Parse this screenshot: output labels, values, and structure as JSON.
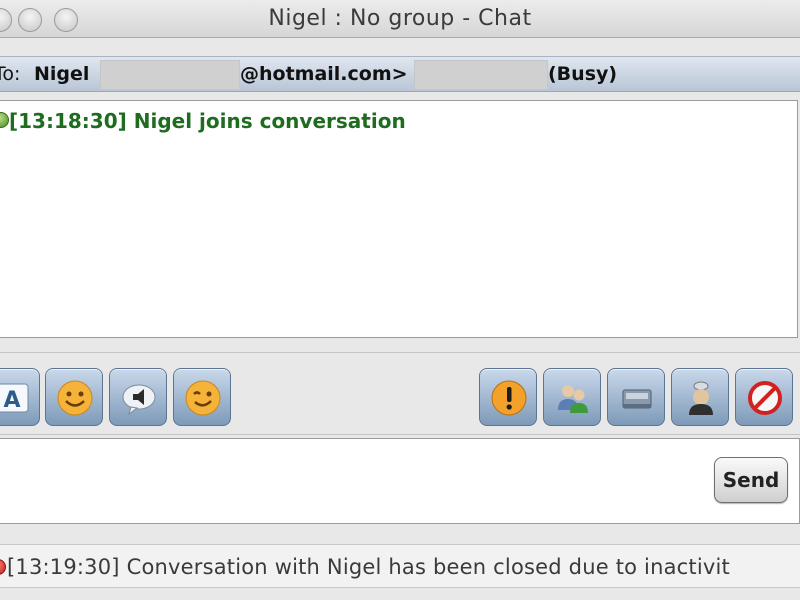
{
  "window": {
    "title": "Nigel : No group - Chat"
  },
  "recipient": {
    "to_label": "To:",
    "name": "Nigel",
    "email_domain": "@hotmail.com>",
    "status": "(Busy)"
  },
  "conversation": {
    "messages": [
      {
        "time": "[13:18:30]",
        "text": "[13:18:30] Nigel joins conversation",
        "indicator": "green-dot-icon"
      }
    ]
  },
  "toolbar": {
    "left_icons": [
      "font-icon",
      "smiley-icon",
      "nudge-icon",
      "wink-icon"
    ],
    "right_icons": [
      "warning-icon",
      "contacts-icon",
      "file-transfer-icon",
      "webcam-icon",
      "block-icon"
    ],
    "font_label": "A"
  },
  "compose": {
    "send_label": "Send"
  },
  "status_bar": {
    "text": "[13:19:30] Conversation with Nigel has been closed due to inactivit",
    "indicator": "red-dot-icon"
  },
  "colors": {
    "join_text": "#1f6b1f",
    "recipient_bar": "#c8d3e1",
    "button_blue": "#8fa9c7"
  }
}
